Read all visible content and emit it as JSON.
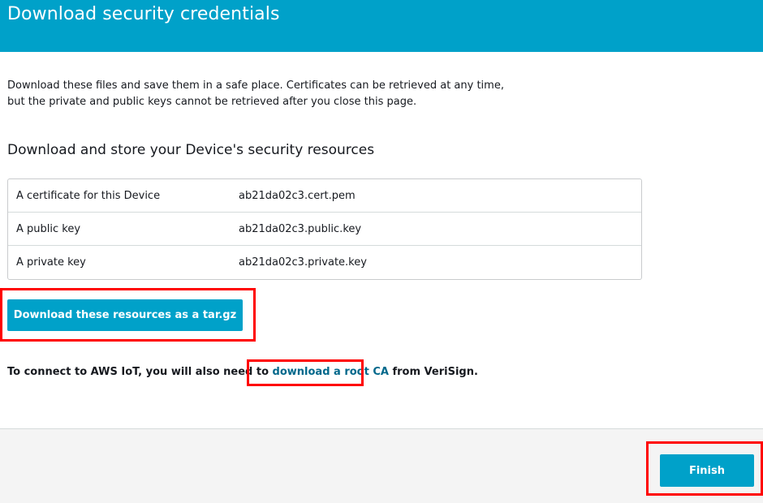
{
  "header": {
    "title": "Download security credentials",
    "color": "#00a1c9"
  },
  "intro": {
    "line1": "Download these files and save them in a safe place. Certificates can be retrieved at any time,",
    "line2": "but the private and public keys cannot be retrieved after you close this page."
  },
  "section_title": "Download and store your Device's security resources",
  "resources": [
    {
      "label": "A certificate for this Device",
      "file": "ab21da02c3.cert.pem"
    },
    {
      "label": "A public key",
      "file": "ab21da02c3.public.key"
    },
    {
      "label": "A private key",
      "file": "ab21da02c3.private.key"
    }
  ],
  "download_button_label": "Download these resources as a tar.gz",
  "connect_note": {
    "prefix": "To connect to AWS IoT, you will also need to ",
    "link_text": "download a root CA",
    "suffix": " from VeriSign."
  },
  "footer": {
    "finish_label": "Finish"
  },
  "colors": {
    "accent": "#00a1c9",
    "link": "#00688b",
    "highlight": "#ff0000"
  }
}
